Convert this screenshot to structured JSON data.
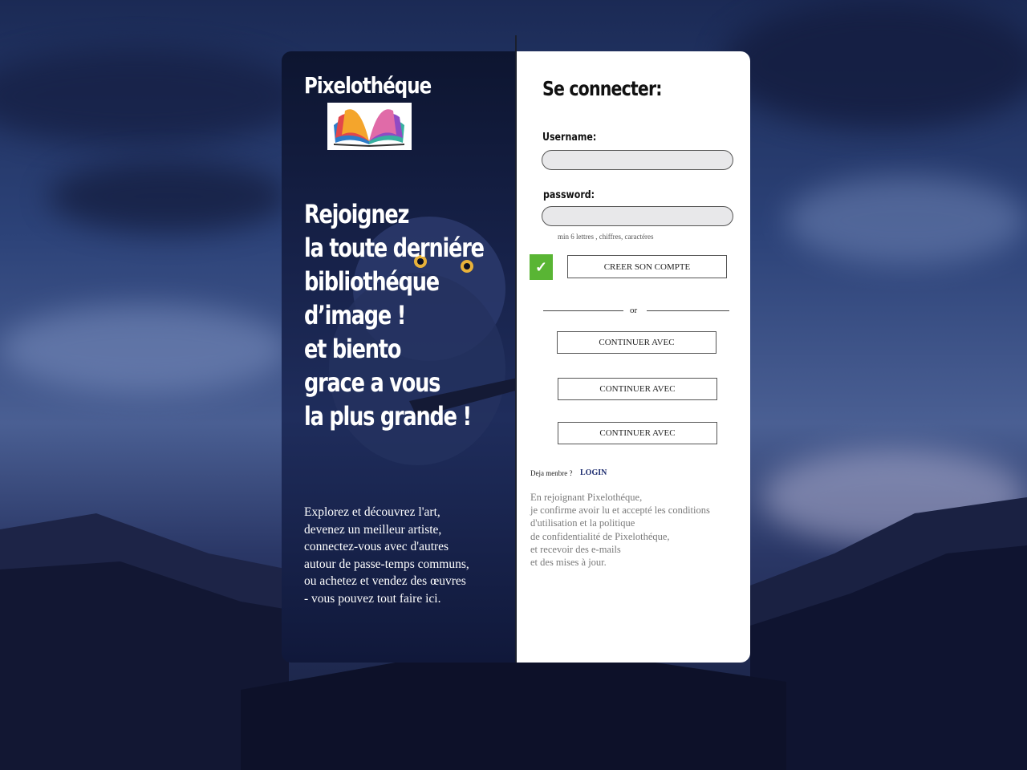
{
  "brand": {
    "name": "Pixelothéque",
    "logo_icon": "open-book-icon"
  },
  "hero": {
    "headline_lines": [
      "Rejoignez",
      "la toute derniére",
      "bibliothéque",
      "d’image !",
      "et biento",
      "grace a vous",
      "la plus grande !"
    ],
    "description_lines": [
      "Explorez et découvrez l'art,",
      "devenez un meilleur artiste,",
      "connectez-vous avec d'autres",
      "autour de passe-temps communs,",
      "ou achetez et vendez des œuvres",
      "- vous pouvez tout faire ici."
    ]
  },
  "form": {
    "title": "Se connecter:",
    "username_label": "Username:",
    "username_value": "",
    "password_label": "password:",
    "password_value": "",
    "password_hint": "min 6 lettres , chiffres, caractéres",
    "checkbox_checked": true,
    "create_button": "CREER SON COMPTE",
    "or_text": "or",
    "oauth_buttons": [
      "CONTINUER AVEC",
      "CONTINUER AVEC",
      "CONTINUER AVEC"
    ],
    "member_text": "Deja menbre ?",
    "login_link": "LOGIN",
    "legal_lines": [
      "En rejoignant Pixelothéque,",
      "je confirme avoir lu et accepté les conditions",
      "d'utilisation et la politique",
      "de confidentialité de Pixelothéque,",
      "et recevoir des e-mails",
      "et des mises à jour."
    ]
  },
  "colors": {
    "accent_green": "#59b534",
    "link": "#1c2b6e",
    "input_bg": "#e8e8ea"
  }
}
